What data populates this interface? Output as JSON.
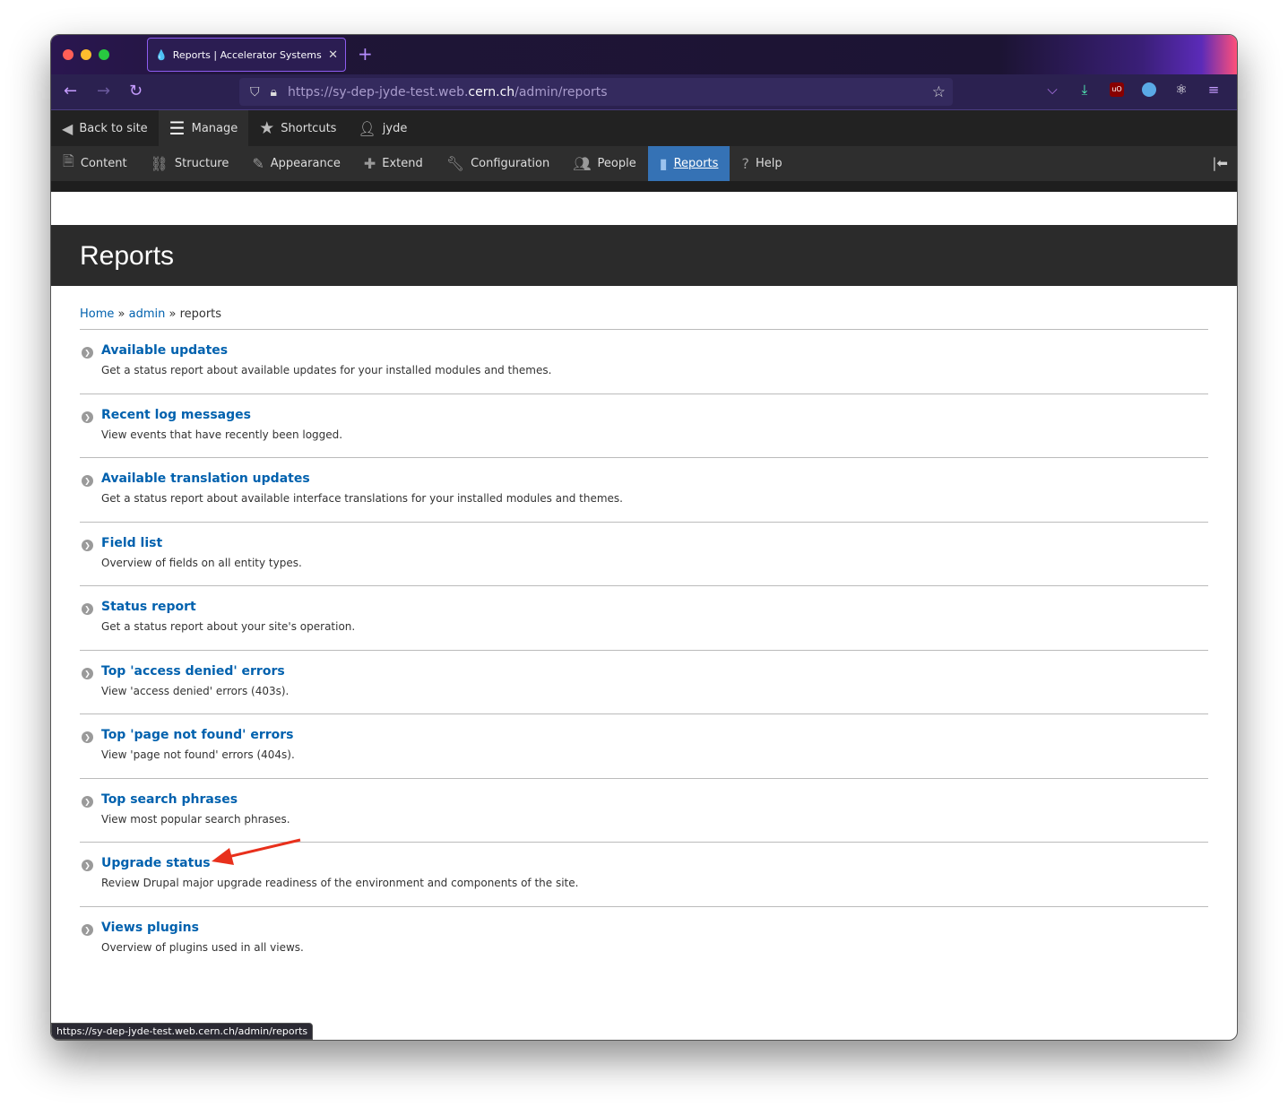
{
  "browser": {
    "tab_title": "Reports | Accelerator Systems D",
    "url_prefix": "https://sy-dep-jyde-test.web.",
    "url_domain": "cern.ch",
    "url_path": "/admin/reports",
    "status_url": "https://sy-dep-jyde-test.web.cern.ch/admin/reports"
  },
  "toolbar": {
    "back": "Back to site",
    "manage": "Manage",
    "shortcuts": "Shortcuts",
    "user": "jyde"
  },
  "menu": [
    {
      "label": "Content",
      "icon": "file-icon"
    },
    {
      "label": "Structure",
      "icon": "sitemap-icon"
    },
    {
      "label": "Appearance",
      "icon": "brush-icon"
    },
    {
      "label": "Extend",
      "icon": "puzzle-icon"
    },
    {
      "label": "Configuration",
      "icon": "wrench-icon"
    },
    {
      "label": "People",
      "icon": "people-icon"
    },
    {
      "label": "Reports",
      "icon": "bar-chart-icon",
      "active": true
    },
    {
      "label": "Help",
      "icon": "help-icon"
    }
  ],
  "page": {
    "title": "Reports"
  },
  "breadcrumb": {
    "home": "Home",
    "admin": "admin",
    "current": "reports"
  },
  "reports": {
    "items": [
      {
        "title": "Available updates",
        "desc": "Get a status report about available updates for your installed modules and themes."
      },
      {
        "title": "Recent log messages",
        "desc": "View events that have recently been logged."
      },
      {
        "title": "Available translation updates",
        "desc": "Get a status report about available interface translations for your installed modules and themes."
      },
      {
        "title": "Field list",
        "desc": "Overview of fields on all entity types."
      },
      {
        "title": "Status report",
        "desc": "Get a status report about your site's operation."
      },
      {
        "title": "Top 'access denied' errors",
        "desc": "View 'access denied' errors (403s)."
      },
      {
        "title": "Top 'page not found' errors",
        "desc": "View 'page not found' errors (404s)."
      },
      {
        "title": "Top search phrases",
        "desc": "View most popular search phrases."
      },
      {
        "title": "Upgrade status",
        "desc": "Review Drupal major upgrade readiness of the environment and components of the site."
      },
      {
        "title": "Views plugins",
        "desc": "Overview of plugins used in all views."
      }
    ]
  },
  "colors": {
    "link": "#0061ae",
    "active_menu": "#3572b5",
    "annotation_arrow": "#e8301c"
  }
}
